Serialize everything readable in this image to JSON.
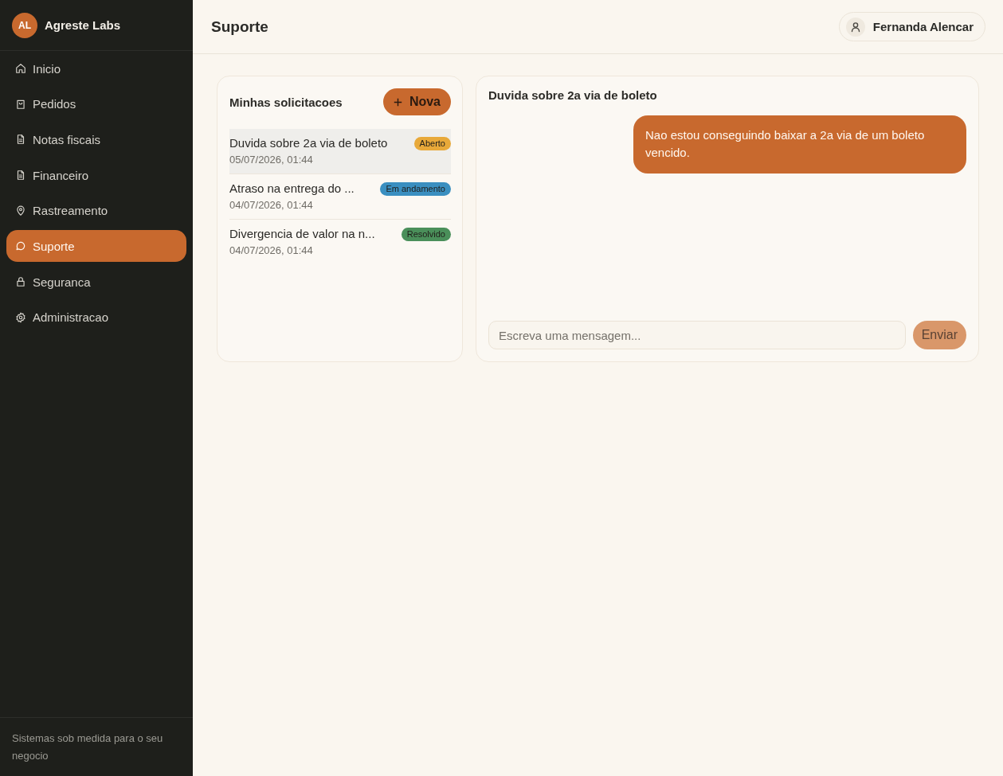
{
  "sidebar": {
    "brand": {
      "initials": "AL",
      "name": "Agreste Labs"
    },
    "items": [
      {
        "label": "Inicio",
        "selected": false
      },
      {
        "label": "Pedidos",
        "selected": false
      },
      {
        "label": "Notas fiscais",
        "selected": false
      },
      {
        "label": "Financeiro",
        "selected": false
      },
      {
        "label": "Rastreamento",
        "selected": false
      },
      {
        "label": "Suporte",
        "selected": true
      },
      {
        "label": "Seguranca",
        "selected": false
      },
      {
        "label": "Administracao",
        "selected": false
      }
    ],
    "footer": "Sistemas sob medida para o seu negocio"
  },
  "header": {
    "title": "Suporte",
    "user": "Fernanda Alencar"
  },
  "tickets": {
    "title": "Minhas solicitacoes",
    "new_button": "Nova",
    "items": [
      {
        "title": "Duvida sobre 2a via de boleto",
        "date": "05/07/2026, 01:44",
        "status": "Aberto",
        "color": "#e8a93a",
        "selected": true
      },
      {
        "title": "Atraso na entrega do ...",
        "date": "04/07/2026, 01:44",
        "status": "Em andamento",
        "color": "#3a8fc0",
        "selected": false
      },
      {
        "title": "Divergencia de valor na n...",
        "date": "04/07/2026, 01:44",
        "status": "Resolvido",
        "color": "#4a8f5a",
        "selected": false
      }
    ]
  },
  "chat": {
    "title": "Duvida sobre 2a via de boleto",
    "messages": [
      {
        "kind": "outgoing",
        "text": "Nao estou conseguindo baixar a 2a via de um boleto vencido."
      }
    ],
    "input": {
      "placeholder": "Escreva uma mensagem..."
    },
    "send_button": {
      "label": "Enviar",
      "disabled": true
    }
  }
}
